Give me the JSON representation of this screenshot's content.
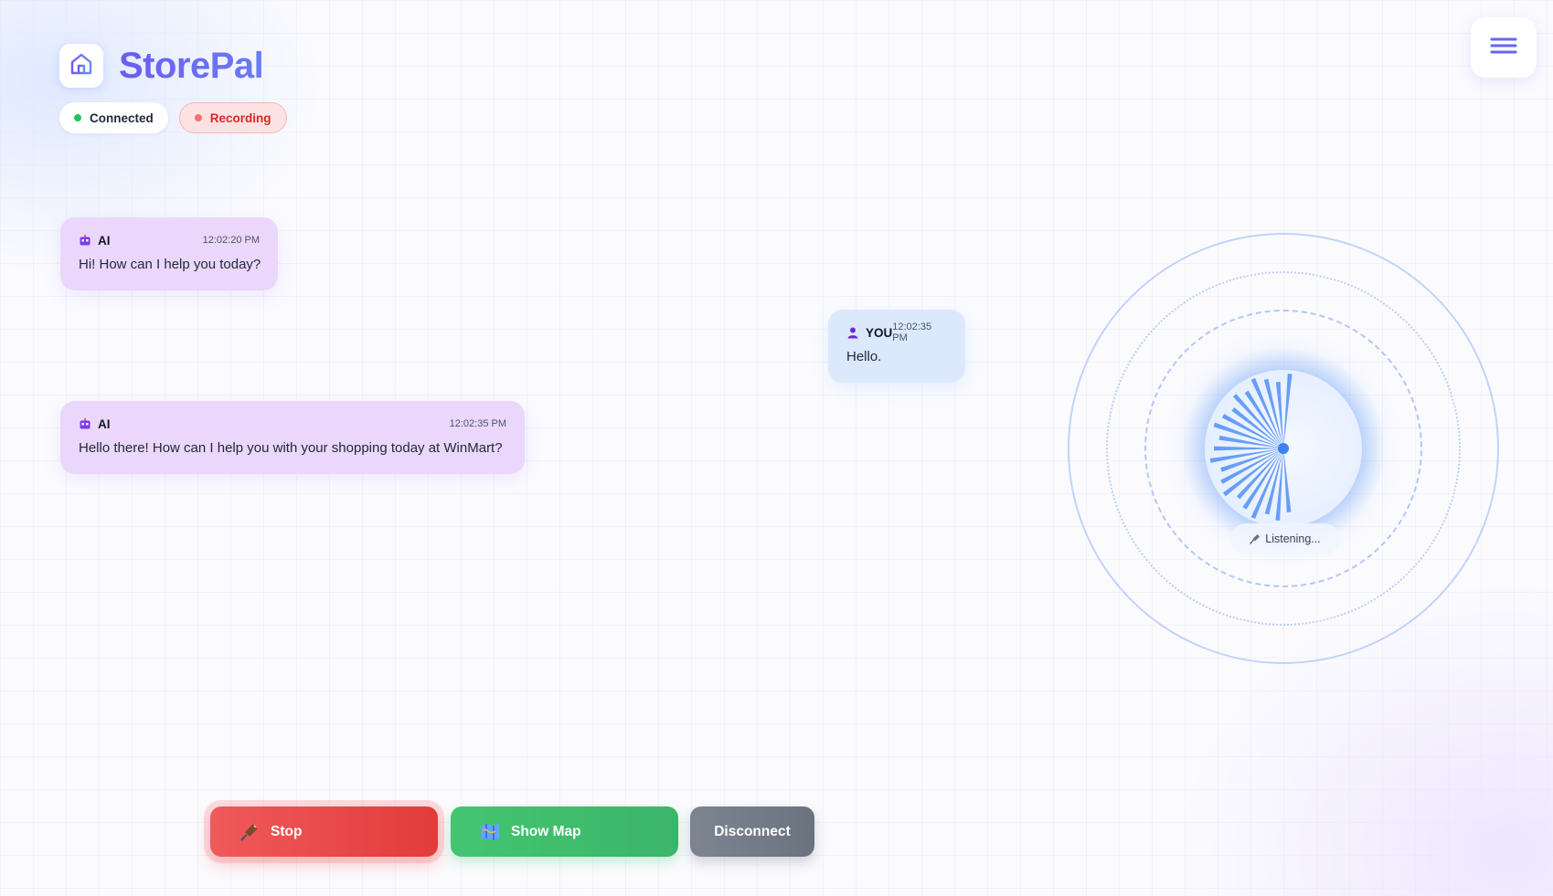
{
  "app": {
    "title": "StorePal",
    "home_icon": "home-icon",
    "menu_icon": "hamburger-menu-icon",
    "accent_color": "#6366f1"
  },
  "status": {
    "connected_label": "Connected",
    "connected_color": "#22c55e",
    "recording_label": "Recording",
    "recording_color": "#dc2626"
  },
  "messages": [
    {
      "sender": "AI",
      "icon": "robot-icon",
      "time": "12:02:20 PM",
      "text": "Hi! How can I help you today?"
    },
    {
      "sender": "YOU",
      "icon": "user-icon",
      "time": "12:02:35 PM",
      "text": "Hello."
    },
    {
      "sender": "AI",
      "icon": "robot-icon",
      "time": "12:02:35 PM",
      "text": "Hello there! How can I help you with your shopping today at WinMart?"
    }
  ],
  "visualizer": {
    "status_label": "Listening...",
    "status_icon": "microphone-icon",
    "color": "#3b82f6"
  },
  "controls": {
    "stop_label": "Stop",
    "stop_icon": "microphone-icon",
    "stop_color": "#ef4444",
    "map_label": "Show Map",
    "map_icon": "map-icon",
    "map_color": "#22c55e",
    "disconnect_label": "Disconnect",
    "disconnect_color": "#6b7280"
  }
}
